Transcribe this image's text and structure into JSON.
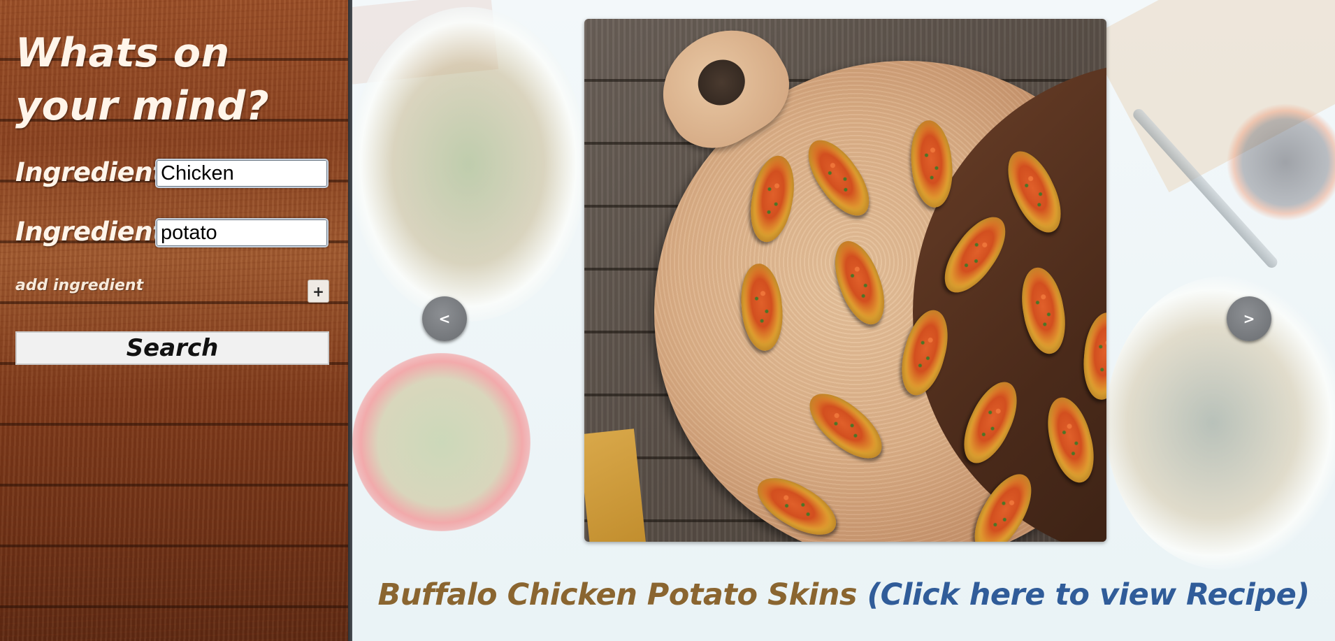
{
  "sidebar": {
    "heading": "Whats on your mind?",
    "ingredients": [
      {
        "label": "Ingredient",
        "value": "Chicken"
      },
      {
        "label": "Ingredient",
        "value": "potato"
      }
    ],
    "add_ingredient_label": "add ingredient",
    "add_button_label": "+",
    "search_button_label": "Search"
  },
  "carousel": {
    "prev_label": "<",
    "next_label": ">"
  },
  "recipe": {
    "name": "Buffalo Chicken Potato Skins",
    "link_text": "(Click here to view Recipe)",
    "name_color": "#8a6530",
    "link_color": "#305c99"
  }
}
